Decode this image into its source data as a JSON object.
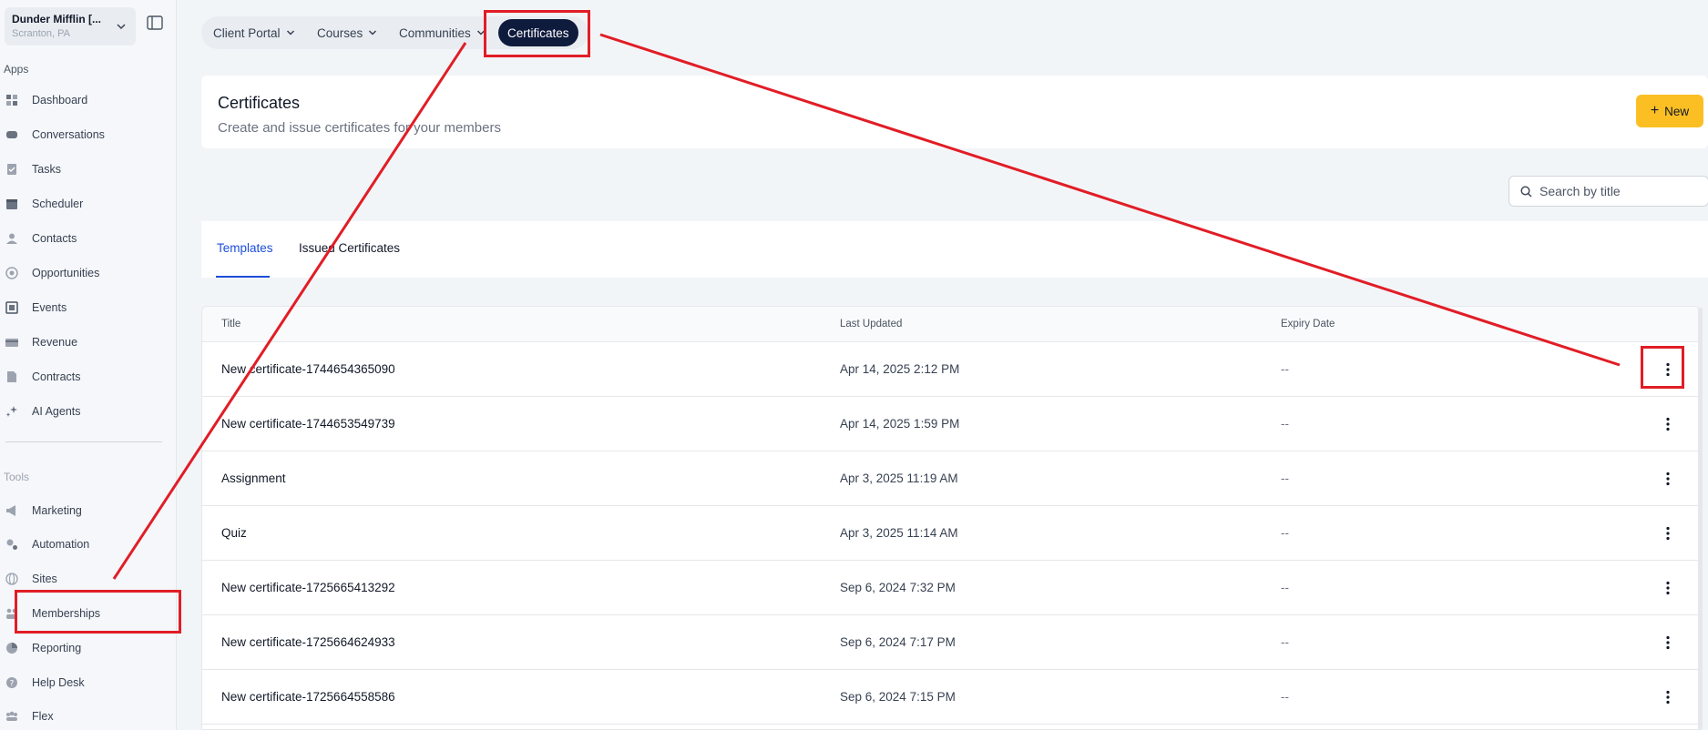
{
  "account": {
    "name": "Dunder Mifflin [...",
    "location": "Scranton, PA"
  },
  "sidebar": {
    "apps_label": "Apps",
    "tools_label": "Tools",
    "apps": [
      {
        "label": "Dashboard",
        "icon": "dashboard-icon"
      },
      {
        "label": "Conversations",
        "icon": "chat-icon"
      },
      {
        "label": "Tasks",
        "icon": "tasks-icon"
      },
      {
        "label": "Scheduler",
        "icon": "calendar-icon"
      },
      {
        "label": "Contacts",
        "icon": "user-icon"
      },
      {
        "label": "Opportunities",
        "icon": "target-icon"
      },
      {
        "label": "Events",
        "icon": "events-icon"
      },
      {
        "label": "Revenue",
        "icon": "card-icon"
      },
      {
        "label": "Contracts",
        "icon": "document-icon"
      },
      {
        "label": "AI Agents",
        "icon": "sparkle-icon"
      }
    ],
    "tools": [
      {
        "label": "Marketing",
        "icon": "megaphone-icon"
      },
      {
        "label": "Automation",
        "icon": "gears-icon"
      },
      {
        "label": "Sites",
        "icon": "globe-icon"
      },
      {
        "label": "Memberships",
        "icon": "members-icon"
      },
      {
        "label": "Reporting",
        "icon": "pie-icon"
      },
      {
        "label": "Help Desk",
        "icon": "help-icon"
      },
      {
        "label": "Flex",
        "icon": "group-icon"
      }
    ]
  },
  "topnav": {
    "items": [
      {
        "label": "Client Portal"
      },
      {
        "label": "Courses"
      },
      {
        "label": "Communities"
      }
    ],
    "active": "Certificates"
  },
  "header": {
    "title": "Certificates",
    "subtitle": "Create and issue certificates for your members",
    "new_label": "New"
  },
  "search": {
    "placeholder": "Search by title"
  },
  "tabs": [
    {
      "label": "Templates",
      "active": true
    },
    {
      "label": "Issued Certificates",
      "active": false
    }
  ],
  "table": {
    "columns": [
      "Title",
      "Last Updated",
      "Expiry Date"
    ],
    "rows": [
      {
        "title": "New certificate-1744654365090",
        "updated": "Apr 14, 2025 2:12 PM",
        "expiry": "--"
      },
      {
        "title": "New certificate-1744653549739",
        "updated": "Apr 14, 2025 1:59 PM",
        "expiry": "--"
      },
      {
        "title": "Assignment",
        "updated": "Apr 3, 2025 11:19 AM",
        "expiry": "--"
      },
      {
        "title": "Quiz",
        "updated": "Apr 3, 2025 11:14 AM",
        "expiry": "--"
      },
      {
        "title": "New certificate-1725665413292",
        "updated": "Sep 6, 2024 7:32 PM",
        "expiry": "--"
      },
      {
        "title": "New certificate-1725664624933",
        "updated": "Sep 6, 2024 7:17 PM",
        "expiry": "--"
      },
      {
        "title": "New certificate-1725664558586",
        "updated": "Sep 6, 2024 7:15 PM",
        "expiry": "--"
      }
    ]
  },
  "colors": {
    "accent": "#1d4ed8",
    "primary_button": "#fbbf24",
    "active_pill": "#0f1b3d",
    "annotation": "#e11d26"
  }
}
